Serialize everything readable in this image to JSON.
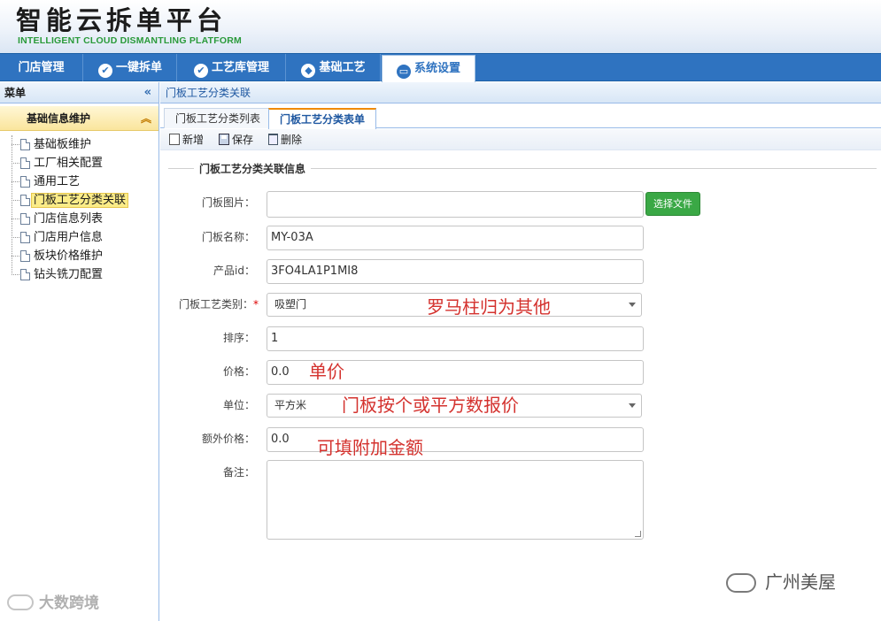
{
  "header": {
    "title_cn": "智能云拆单平台",
    "title_en": "INTELLIGENT CLOUD DISMANTLING PLATFORM"
  },
  "topnav": {
    "items": [
      {
        "label": "门店管理",
        "icon": "none"
      },
      {
        "label": "一键拆单",
        "icon": "check-circle-icon"
      },
      {
        "label": "工艺库管理",
        "icon": "check-circle-icon"
      },
      {
        "label": "基础工艺",
        "icon": "diamond-circle-icon"
      },
      {
        "label": "系统设置",
        "icon": "monitor-icon",
        "active": true
      }
    ]
  },
  "sidebar": {
    "title": "菜单",
    "collapse_glyph": "«",
    "group": "基础信息维护",
    "group_toggle_glyph": "︽",
    "items": [
      {
        "label": "基础板维护"
      },
      {
        "label": "工厂相关配置"
      },
      {
        "label": "通用工艺"
      },
      {
        "label": "门板工艺分类关联",
        "selected": true
      },
      {
        "label": "门店信息列表"
      },
      {
        "label": "门店用户信息"
      },
      {
        "label": "板块价格维护"
      },
      {
        "label": "钻头铣刀配置"
      }
    ]
  },
  "breadcrumb": "门板工艺分类关联",
  "tabs": [
    {
      "label": "门板工艺分类列表"
    },
    {
      "label": "门板工艺分类表单",
      "active": true
    }
  ],
  "toolbar": {
    "new_label": "新增",
    "save_label": "保存",
    "delete_label": "删除"
  },
  "form": {
    "legend": "门板工艺分类关联信息",
    "image_label": "门板图片：",
    "image_value": "",
    "choose_file_label": "选择文件",
    "name_label": "门板名称：",
    "name_value": "MY-03A",
    "product_id_label": "产品id：",
    "product_id_value": "3FO4LA1P1MI8",
    "category_label": "门板工艺类别：",
    "category_required_mark": "*",
    "category_value": "吸塑门",
    "sort_label": "排序：",
    "sort_value": "1",
    "price_label": "价格：",
    "price_value": "0.0",
    "unit_label": "单位：",
    "unit_value": "平方米",
    "extra_price_label": "额外价格：",
    "extra_price_value": "0.0",
    "remark_label": "备注：",
    "remark_value": ""
  },
  "annotations": {
    "category_note": "罗马柱归为其他",
    "price_note": "单价",
    "unit_note": "门板按个或平方数报价",
    "extra_price_note": "可填附加金额"
  },
  "watermarks": {
    "left": "大数跨境",
    "right": "广州美屋"
  },
  "colors": {
    "nav_blue": "#2f73c0",
    "annotation_red": "#d4322e",
    "green_button": "#3aa845",
    "selected_yellow": "#fbec88"
  }
}
